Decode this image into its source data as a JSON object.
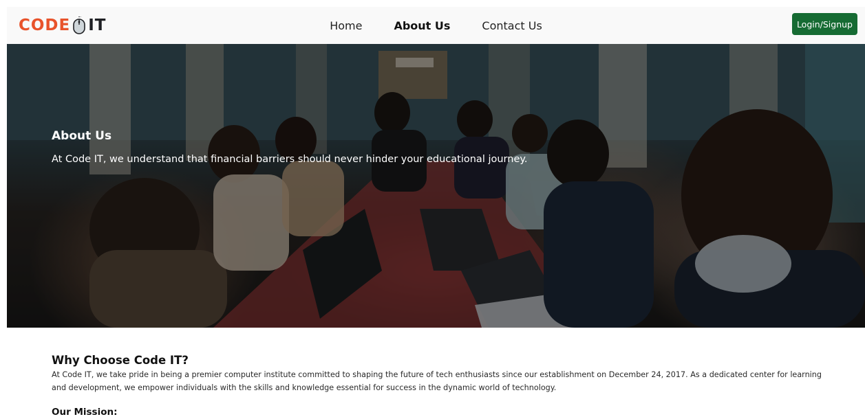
{
  "brand": {
    "logo_left": "CODE",
    "logo_right": "IT",
    "colors": {
      "accent": "#e8532b",
      "dark": "#1f2024",
      "button": "#166b33"
    }
  },
  "nav": {
    "links": [
      {
        "label": "Home",
        "active": false
      },
      {
        "label": "About Us",
        "active": true
      },
      {
        "label": "Contact Us",
        "active": false
      }
    ],
    "login_label": "Login/Signup"
  },
  "hero": {
    "title": "About Us",
    "subtitle": "At Code IT, we understand that financial barriers should never hinder your educational journey.",
    "image_subject": "students-working-on-laptops"
  },
  "why": {
    "title": "Why Choose Code IT?",
    "text": "At Code IT, we take pride in being a premier computer institute committed to shaping the future of tech enthusiasts since our establishment on December 24, 2017. As a dedicated center for learning and development, we empower individuals with the skills and knowledge essential for success in the dynamic world of technology."
  },
  "mission": {
    "title": "Our Mission:"
  }
}
